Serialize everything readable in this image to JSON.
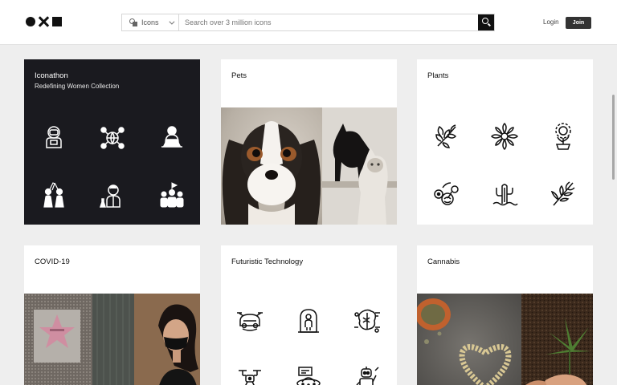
{
  "header": {
    "search_type_label": "Icons",
    "search_placeholder": "Search over 3 million icons",
    "login_label": "Login",
    "join_label": "Join"
  },
  "collections": [
    {
      "title": "Iconathon",
      "subtitle": "Redefining Women Collection"
    },
    {
      "title": "Pets"
    },
    {
      "title": "Plants"
    },
    {
      "title": "COVID-19"
    },
    {
      "title": "Futuristic Technology"
    },
    {
      "title": "Cannabis"
    }
  ],
  "colors": {
    "dark_card": "#1a1a1f",
    "join_button": "#333333",
    "page_background": "#eeeeee"
  },
  "icons": {
    "iconathon": [
      "astronaut-icon",
      "globe-network-icon",
      "woman-laptop-icon",
      "high-five-icon",
      "scientist-icon",
      "group-icon"
    ],
    "plants": [
      "herb-icon",
      "flower-icon",
      "sunflower-pot-icon",
      "succulent-icon",
      "cactus-icon",
      "branch-icon"
    ],
    "futuristic": [
      "flying-car-icon",
      "capsule-person-icon",
      "brain-circuit-icon",
      "drone-icon",
      "hologram-ufo-icon",
      "robot-icon"
    ]
  }
}
